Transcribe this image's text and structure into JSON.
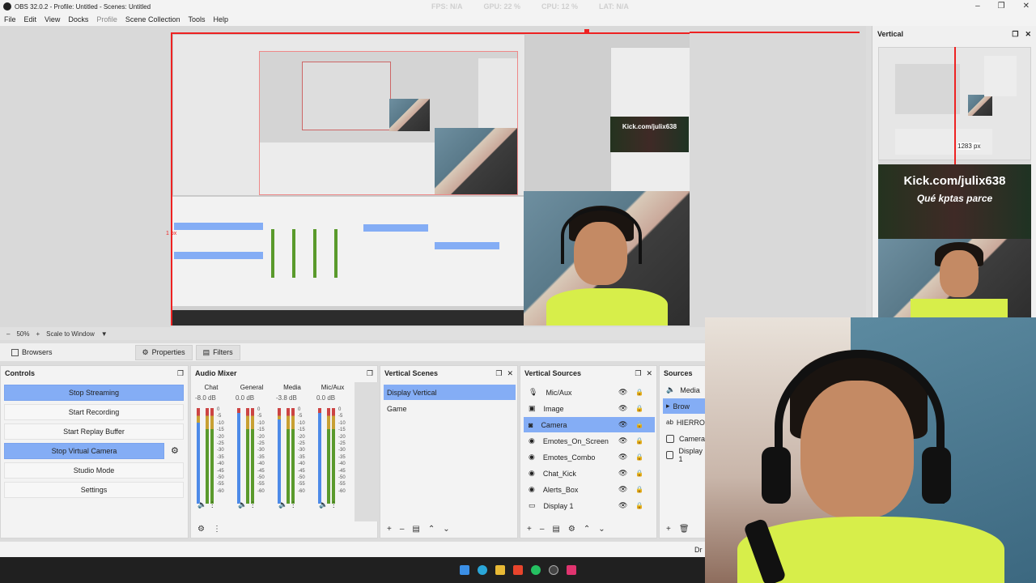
{
  "window": {
    "title": "OBS 32.0.2 - Profile: Untitled - Scenes: Untitled",
    "stats": [
      "FPS: N/A",
      "GPU: 22 %",
      "CPU: 12 %",
      "LAT: N/A"
    ],
    "controls": [
      "–",
      "❐",
      "✕"
    ]
  },
  "menu": [
    "File",
    "Edit",
    "View",
    "Docks",
    "Profile",
    "Scene Collection",
    "Tools",
    "Help"
  ],
  "preview": {
    "zoom": "50%",
    "scale_mode": "Scale to Window",
    "overlay_label": "1 px",
    "banner_text": "Kick.com/julix638",
    "banner_sub": "Qué kptas parce"
  },
  "vertical_dock": {
    "title": "Vertical",
    "banner_text": "Kick.com/julix638",
    "banner_sub": "Qué kptas parce",
    "size_label": "1283 px"
  },
  "tabs": [
    {
      "label": "Browsers",
      "icon": "folder-icon"
    },
    {
      "label": "Properties",
      "icon": "gear-icon"
    },
    {
      "label": "Filters",
      "icon": "filter-icon"
    }
  ],
  "controls": {
    "title": "Controls",
    "buttons": [
      {
        "label": "Stop Streaming",
        "active": true
      },
      {
        "label": "Start Recording",
        "active": false
      },
      {
        "label": "Start Replay Buffer",
        "active": false
      },
      {
        "label": "Stop Virtual Camera",
        "active": true
      },
      {
        "label": "Studio Mode",
        "active": false
      },
      {
        "label": "Settings",
        "active": false
      }
    ]
  },
  "mixer": {
    "title": "Audio Mixer",
    "channels": [
      {
        "name": "Chat",
        "db": "-8.0 dB",
        "level": 0.85
      },
      {
        "name": "General",
        "db": "0.0 dB",
        "level": 0.95
      },
      {
        "name": "Media",
        "db": "-3.8 dB",
        "level": 0.88
      },
      {
        "name": "Mic/Aux",
        "db": "0.0 dB",
        "level": 0.95
      }
    ],
    "ticks": [
      "0",
      "-5",
      "-10",
      "-15",
      "-20",
      "-25",
      "-30",
      "-35",
      "-40",
      "-45",
      "-50",
      "-55",
      "-60"
    ]
  },
  "vscenes": {
    "title": "Vertical Scenes",
    "items": [
      {
        "label": "Display Vertical",
        "selected": true
      },
      {
        "label": "Game",
        "selected": false
      }
    ]
  },
  "vsources": {
    "title": "Vertical Sources",
    "items": [
      {
        "label": "Mic/Aux",
        "icon": "mic-icon",
        "selected": false
      },
      {
        "label": "Image",
        "icon": "image-icon",
        "selected": false
      },
      {
        "label": "Camera",
        "icon": "camera-icon",
        "selected": true
      },
      {
        "label": "Emotes_On_Screen",
        "icon": "browser-icon",
        "selected": false
      },
      {
        "label": "Emotes_Combo",
        "icon": "browser-icon",
        "selected": false
      },
      {
        "label": "Chat_Kick",
        "icon": "browser-icon",
        "selected": false
      },
      {
        "label": "Alerts_Box",
        "icon": "browser-icon",
        "selected": false
      },
      {
        "label": "Display 1",
        "icon": "display-icon",
        "selected": false
      }
    ]
  },
  "sources": {
    "title": "Sources",
    "items": [
      {
        "label": "Media",
        "selected": false
      },
      {
        "label": "Brow",
        "selected": true
      },
      {
        "label": "HIERRO",
        "selected": false
      },
      {
        "label": "Camera",
        "selected": false
      },
      {
        "label": "Display 1",
        "selected": false
      }
    ]
  },
  "status": {
    "text": "Dr"
  }
}
